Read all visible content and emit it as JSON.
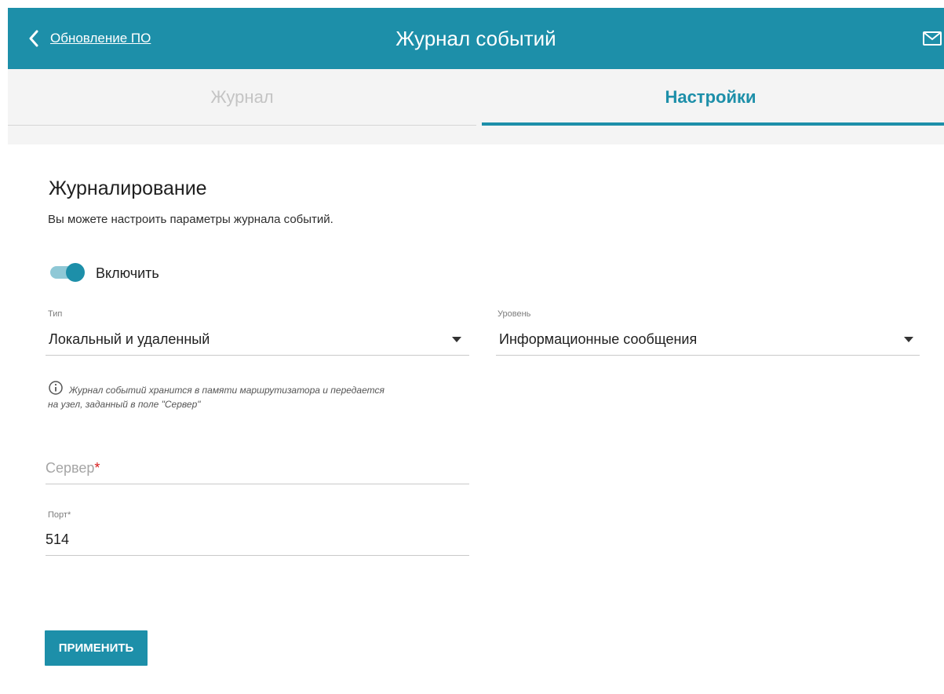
{
  "header": {
    "back_label": "Обновление ПО",
    "title": "Журнал событий",
    "mail_icon": "mail-icon",
    "back_icon": "chevron-left-icon"
  },
  "tabs": [
    {
      "label": "Журнал",
      "active": false
    },
    {
      "label": "Настройки",
      "active": true
    }
  ],
  "section": {
    "title": "Журналирование",
    "description": "Вы можете настроить параметры журнала событий."
  },
  "enable": {
    "label": "Включить",
    "checked": true
  },
  "type_select": {
    "label": "Тип",
    "value": "Локальный и удаленный"
  },
  "level_select": {
    "label": "Уровень",
    "value": "Информационные сообщения"
  },
  "info": {
    "icon": "info-icon",
    "line1": "Журнал событий хранится в памяти маршрутизатора и передается",
    "line2": "на узел, заданный в поле \"Сервер\""
  },
  "server_field": {
    "placeholder": "Сервер",
    "required_mark": "*",
    "value": ""
  },
  "port_field": {
    "label": "Порт*",
    "value": "514"
  },
  "apply_button": {
    "label": "ПРИМЕНИТЬ"
  },
  "colors": {
    "accent": "#1d8fa9",
    "tab_inactive": "#c4c4c4",
    "required": "#d81b1b"
  }
}
